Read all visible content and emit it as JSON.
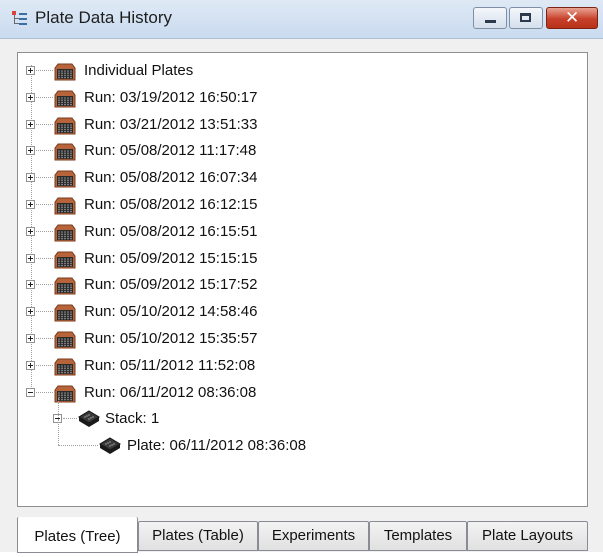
{
  "window": {
    "title": "Plate Data History",
    "close_glyph": "✕",
    "icons": {
      "app": "tree-structure-icon",
      "minimize": "minimize-icon",
      "maximize": "maximize-icon",
      "close": "close-icon"
    }
  },
  "tree": {
    "nodes": [
      {
        "label": "Individual Plates",
        "expanded": false
      },
      {
        "label": "Run: 03/19/2012 16:50:17",
        "expanded": false
      },
      {
        "label": "Run: 03/21/2012 13:51:33",
        "expanded": false
      },
      {
        "label": "Run: 05/08/2012 11:17:48",
        "expanded": false
      },
      {
        "label": "Run: 05/08/2012 16:07:34",
        "expanded": false
      },
      {
        "label": "Run: 05/08/2012 16:12:15",
        "expanded": false
      },
      {
        "label": "Run: 05/08/2012 16:15:51",
        "expanded": false
      },
      {
        "label": "Run: 05/09/2012 15:15:15",
        "expanded": false
      },
      {
        "label": "Run: 05/09/2012 15:17:52",
        "expanded": false
      },
      {
        "label": "Run: 05/10/2012 14:58:46",
        "expanded": false
      },
      {
        "label": "Run: 05/10/2012 15:35:57",
        "expanded": false
      },
      {
        "label": "Run: 05/11/2012 11:52:08",
        "expanded": false
      },
      {
        "label": "Run: 06/11/2012 08:36:08",
        "expanded": true
      }
    ],
    "stack": {
      "label": "Stack: 1",
      "expanded": true
    },
    "plate": {
      "label": "Plate: 06/11/2012 08:36:08"
    }
  },
  "tabs": [
    {
      "label": "Plates (Tree)",
      "active": true
    },
    {
      "label": "Plates (Table)",
      "active": false
    },
    {
      "label": "Experiments",
      "active": false
    },
    {
      "label": "Templates",
      "active": false
    },
    {
      "label": "Plate Layouts",
      "active": false
    }
  ],
  "colors": {
    "folder": "#b8643a",
    "plate": "#2a2a2a",
    "titlebar": "#d5e3f2",
    "close": "#c7402a"
  }
}
